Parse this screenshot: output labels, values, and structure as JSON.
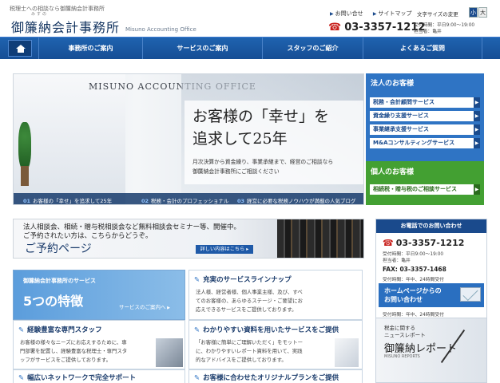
{
  "header": {
    "tagline": "税理士への相談なら御簾納会計事務所",
    "logo_ruby": "みすの",
    "logo": "御簾納会計事務所",
    "logo_en": "Misuno Accounting Office",
    "links": [
      "お問い合せ",
      "サイトマップ"
    ],
    "font_size_label": "文字サイズの変更",
    "font_small": "小",
    "font_large": "大",
    "phone": "03-3357-1212",
    "hours_1": "受付時間：平日9:00～19:00",
    "hours_2": "担当者：亀井"
  },
  "nav": {
    "items": [
      "事務所のご案内",
      "サービスのご案内",
      "スタッフのご紹介",
      "よくあるご質問"
    ]
  },
  "hero": {
    "sign": "MISUNO ACCOUNTING OFFICE",
    "headline_1": "お客様の「幸せ」を",
    "headline_2": "追求して25年",
    "desc_1": "月次決算から資金繰り、事業承継まで、経営のご相談なら",
    "desc_2": "御簾納会計事務所にご相談ください",
    "slides": [
      {
        "num": "01",
        "label": "お客様の「幸せ」を追求して25年"
      },
      {
        "num": "02",
        "label": "税務・会計のプロフェッショナル"
      },
      {
        "num": "03",
        "label": "経営に必要な税務ノウハウが満載の人気ブログ"
      }
    ]
  },
  "corporate": {
    "title": "法人のお客様",
    "items": [
      "税務・会計顧問サービス",
      "資金繰り支援サービス",
      "事業継承支援サービス",
      "M&Aコンサルティングサービス"
    ]
  },
  "personal": {
    "title": "個人のお客様",
    "items": [
      "相続税・贈与税のご相談サービス"
    ]
  },
  "seminar": {
    "line_1": "法人相談会、相続・贈与税相談会など無料相談会セミナー等、開催中。",
    "line_2": "ご予約されたい方は、こちらからどうぞ。",
    "title": "ご予約ページ",
    "button": "詳しい内容はこちら ▸"
  },
  "contact": {
    "title": "お電話でのお問い合わせ",
    "phone": "03-3357-1212",
    "hours_1": "受付時間：平日9:00～19:00",
    "hours_2": "担当者：亀井",
    "fax": "FAX: 03-3357-1468",
    "fax_hours": "受付時間：年中、24時間受付",
    "mail_1": "ホームページからの",
    "mail_2": "お問い合わせ",
    "mail_hours": "受付時間：年中、24時間受付"
  },
  "report": {
    "line_1": "税金に関する",
    "line_2": "ニュースレポート",
    "title": "御簾納レポート",
    "sub": "MISUNO REPORTS"
  },
  "services": {
    "intro": "御簾納会計事務所のサービス",
    "count": "5つの特徴",
    "link": "サービスのご案内へ",
    "cards": [
      {
        "title": "充実のサービスラインナップ",
        "lines": [
          "法人様、経営者様、個人事業主様、及び、すべ",
          "てのお客様の、あらゆるステージ・ご要望にお",
          "応えできるサービスをご提供しております。"
        ]
      },
      {
        "title": "経験豊富な専門スタッフ",
        "lines": [
          "お客様の様々なニーズにお応えするために、専",
          "門部署を配置し、経験豊富な税理士・専門スタ",
          "ッフがサービスをご提供しております。"
        ]
      },
      {
        "title": "わかりやすい資料を用いたサービスをご提供",
        "lines": [
          "「お客様に簡単にご理解いただく」をモットー",
          "に、わかりやすいレポート資料を用いて、実践",
          "的なアドバイスをご提供しております。"
        ]
      },
      {
        "title": "幅広いネットワークで完全サポート",
        "lines": []
      },
      {
        "title": "お客様に合わせたオリジナルプランをご提供",
        "lines": []
      }
    ]
  },
  "colors": {
    "brand": "#1a4a8c",
    "nav": "#1f63b0",
    "accent": "#c8201c",
    "green": "#43a032"
  }
}
